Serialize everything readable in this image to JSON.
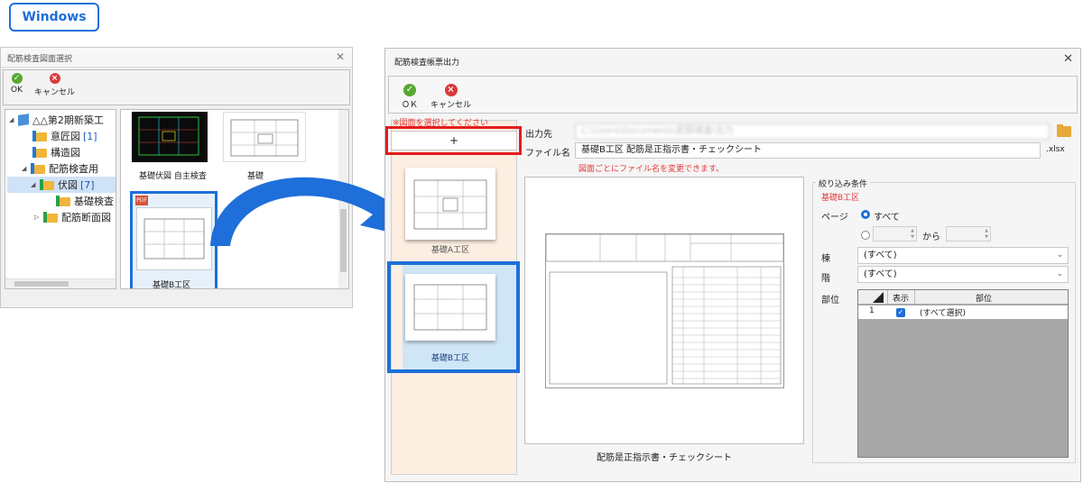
{
  "badge": "Windows",
  "left_dialog": {
    "title": "配筋検査図面選択",
    "toolbar": {
      "ok": "OK",
      "cancel": "キャンセル"
    },
    "tree": [
      {
        "label": "△△第2期新築工",
        "count": ""
      },
      {
        "label": "意匠図",
        "count": "[1]"
      },
      {
        "label": "構造図",
        "count": ""
      },
      {
        "label": "配筋検査用",
        "count": ""
      },
      {
        "label": "伏図",
        "count": "[7]"
      },
      {
        "label": "基礎検査",
        "count": ""
      },
      {
        "label": "配筋断面図",
        "count": ""
      }
    ],
    "thumbnails": [
      {
        "caption": "基礎伏図 自主検査"
      },
      {
        "caption": "基礎"
      },
      {
        "caption": "基礎B工区",
        "badge": "PDF"
      }
    ]
  },
  "right_dialog": {
    "title": "配筋検査帳票出力",
    "toolbar": {
      "ok": "ＯＫ",
      "cancel": "キャンセル"
    },
    "note": "※図面を選択してください",
    "add_button": "+",
    "pages": [
      {
        "caption": "基礎A工区"
      },
      {
        "caption": "基礎B工区"
      }
    ],
    "output_label": "出力先",
    "output_path": "C:\\Users\\Documents\\配筋検査\\出力",
    "filename_label": "ファイル名",
    "filename_value": "基礎B工区 配筋是正指示書・チェックシート",
    "filename_ext": ".xlsx",
    "filename_note": "図面ごとにファイル名を変更できます。",
    "preview_caption": "配筋是正指示書・チェックシート",
    "filter": {
      "title": "絞り込み条件",
      "subtitle": "基礎B工区",
      "page_label": "ページ",
      "page_all": "すべて",
      "range_to": "から",
      "building_label": "棟",
      "building_value": "(すべて)",
      "floor_label": "階",
      "floor_value": "(すべて)",
      "part_label": "部位",
      "grid_headers": {
        "show": "表示",
        "part": "部位"
      },
      "grid_rows": [
        {
          "no": "1",
          "part": "(すべて選択)"
        }
      ]
    }
  },
  "colors": {
    "accent": "#1e6fd9",
    "red_highlight": "#e21c1c",
    "ok": "#58a832",
    "cancel": "#d73c3c"
  }
}
